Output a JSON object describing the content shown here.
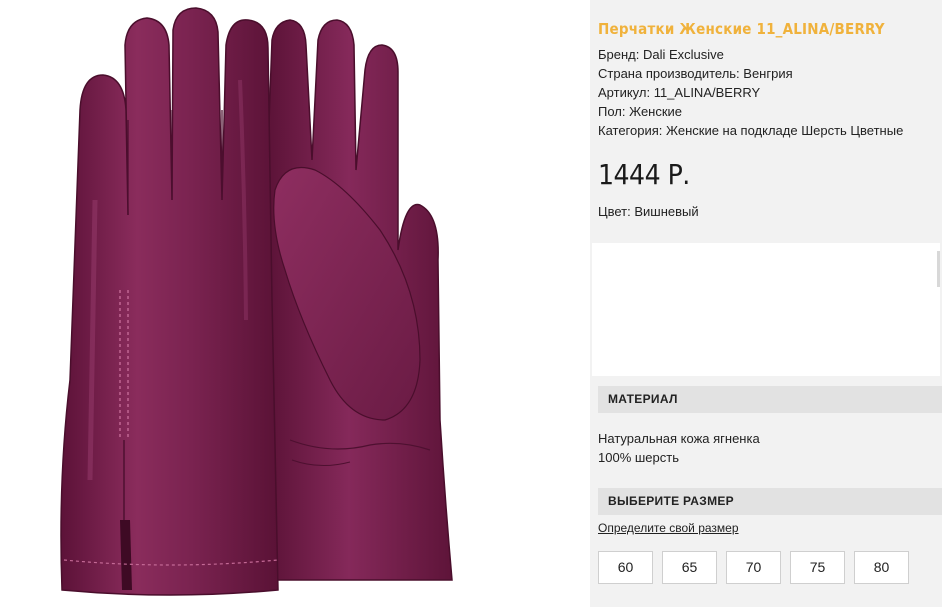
{
  "product": {
    "title": "Перчатки Женские 11_ALINA/BERRY",
    "specs": [
      "Бренд: Dali Exclusive",
      "Страна производитель: Венгрия",
      "Артикул: 11_ALINA/BERRY",
      "Пол: Женские",
      "Категория: Женские на подкладе Шерсть Цветные"
    ],
    "price": "1444 Р.",
    "color": "Цвет: Вишневый"
  },
  "material": {
    "heading": "МАТЕРИАЛ",
    "lines": [
      "Натуральная кожа ягненка",
      "100% шерсть"
    ]
  },
  "size": {
    "heading": "ВЫБЕРИТЕ РАЗМЕР",
    "link": "Определите свой размер",
    "options": [
      "60",
      "65",
      "70",
      "75",
      "80"
    ]
  },
  "image": {
    "subject": "purple leather gloves pair",
    "glove_color": "#7a2350",
    "accent": "#f0b23c"
  }
}
